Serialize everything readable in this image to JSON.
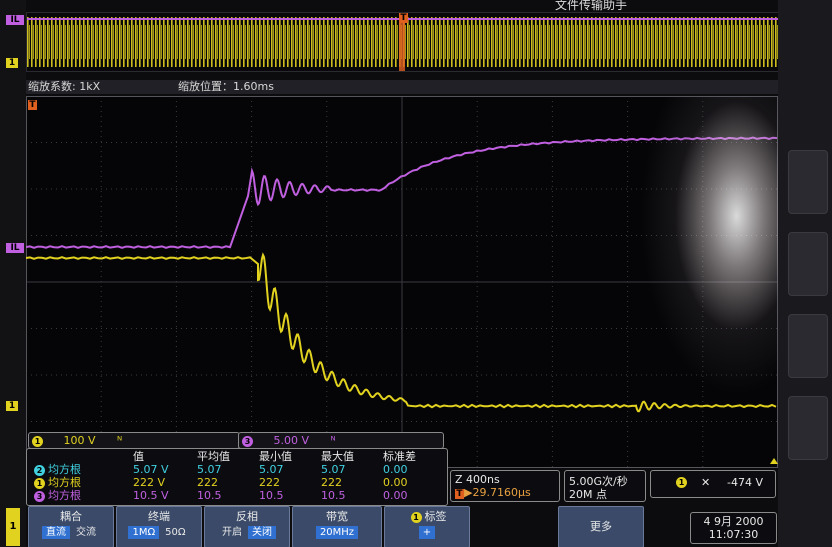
{
  "header_overlay": {
    "text": "文件传输助手"
  },
  "overview": {
    "trigger_marker": "T",
    "ch_label": "1",
    "ch3_label": "IL"
  },
  "zoom_header": {
    "factor_label": "缩放系数: 1kX",
    "position_label": "缩放位置：1.60ms"
  },
  "plot_markers": {
    "ch3": "IL",
    "ch1": "1",
    "trigger": "T",
    "plus": "+"
  },
  "channel_bar": {
    "ch1": {
      "num": "1",
      "scale": "100 V",
      "coupling": "ᴺ"
    },
    "ch3": {
      "num": "3",
      "scale": "5.00 V",
      "coupling": "ᴺ"
    }
  },
  "measurements": {
    "headers": [
      "值",
      "平均值",
      "最小值",
      "最大值",
      "标准差"
    ],
    "rows": [
      {
        "ch": "2",
        "name": "均方根",
        "color": "#40d0e0",
        "values": [
          "5.07 V",
          "5.07",
          "5.07",
          "5.07",
          "0.00"
        ]
      },
      {
        "ch": "1",
        "name": "均方根",
        "color": "#e2d220",
        "values": [
          "222 V",
          "222",
          "222",
          "222",
          "0.00"
        ]
      },
      {
        "ch": "3",
        "name": "均方根",
        "color": "#c060e0",
        "values": [
          "10.5 V",
          "10.5",
          "10.5",
          "10.5",
          "0.00"
        ]
      }
    ]
  },
  "horizontal": {
    "scale": "Z 400ns",
    "position": "▶29.7160µs",
    "trig_icon": "T"
  },
  "acquisition": {
    "rate": "5.00G次/秒",
    "points": "20M 点"
  },
  "trigger_info": {
    "source": "1",
    "slope": "✕",
    "level": "-474 V"
  },
  "softkeys": {
    "coupling": {
      "title": "耦合",
      "options": [
        "直流",
        "交流"
      ],
      "selected": 0
    },
    "termination": {
      "title": "终端",
      "options": [
        "1MΩ",
        "50Ω"
      ],
      "selected": 0
    },
    "invert": {
      "title": "反相",
      "options": [
        "开启",
        "关闭"
      ],
      "selected": 1
    },
    "bandwidth": {
      "title": "带宽",
      "value": "20MHz"
    },
    "label": {
      "num": "1",
      "title": "标签"
    },
    "more": {
      "title": "更多"
    }
  },
  "side_label": "1",
  "datetime": {
    "date": "4 9月 2000",
    "time": "11:07:30"
  },
  "colors": {
    "ch1": "#e2d220",
    "ch3": "#c060e0",
    "ch2": "#40d0e0",
    "grid": "#3a3a40"
  }
}
